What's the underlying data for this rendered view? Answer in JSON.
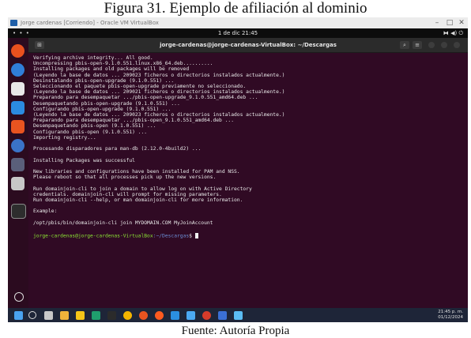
{
  "caption": {
    "top": "Figura 31. Ejemplo de afiliación al dominio",
    "bottom": "Fuente: Autoría Propia"
  },
  "vbox_window": {
    "title": "Jorge cardenas [Corriendo] - Oracle VM VirtualBox",
    "buttons": [
      "–",
      "□",
      "✕"
    ]
  },
  "gnome_bar": {
    "activities": "• • •",
    "clock": "1 de dic 21:45",
    "tray": "⧓ ◀) ⏻"
  },
  "terminal": {
    "title": "jorge-cardenas@jorge-cardenas-VirtualBox: ~/Descargas",
    "new_tab": "⊞",
    "lines": [
      "Verifying archive integrity... All good.",
      "Uncompressing pbis-open-9.1.0.551.linux.x86_64.deb..........",
      "Installing packages and old packages will be removed",
      "(Leyendo la base de datos ... 209023 ficheros o directorios instalados actualmente.)",
      "Desinstalando pbis-open-upgrade (9.1.0.551) ...",
      "Seleccionando el paquete pbis-open-upgrade previamente no seleccionado.",
      "(Leyendo la base de datos ... 209021 ficheros o directorios instalados actualmente.)",
      "Preparando para desempaquetar .../pbis-open-upgrade_9.1.0.551_amd64.deb ...",
      "Desempaquetando pbis-open-upgrade (9.1.0.551) ...",
      "Configurando pbis-open-upgrade (9.1.0.551) ...",
      "(Leyendo la base de datos ... 209023 ficheros o directorios instalados actualmente.)",
      "Preparando para desempaquetar .../pbis-open_9.1.0.551_amd64.deb ...",
      "Desempaquetando pbis-open (9.1.0.551) ...",
      "Configurando pbis-open (9.1.0.551) ...",
      "Importing registry...",
      "",
      "Procesando disparadores para man-db (2.12.0-4build2) ...",
      "",
      "Installing Packages was successful",
      "",
      "New libraries and configurations have been installed for PAM and NSS.",
      "Please reboot so that all processes pick up the new versions.",
      "",
      "Run domainjoin-cli to join a domain to allow log on with Active Directory",
      "credentials. domainjoin-cli will prompt for missing parameters.",
      "Run domainjoin-cli --help, or man domainjoin-cli for more information.",
      "",
      "Example:",
      "",
      "/opt/pbis/bin/domainjoin-cli join MYDOMAIN.COM MyJoinAccount",
      ""
    ],
    "prompt_user": "jorge-cardenas@jorge-cardenas-VirtualBox",
    "prompt_path": ":~/Descargas",
    "prompt_symbol": "$"
  },
  "taskbar": {
    "time": "21:45 p. m.",
    "date": "01/12/2024"
  },
  "colors": {
    "terminal_bg": "#300a24",
    "prompt_user": "#8ae234",
    "prompt_path": "#6b8ed6"
  }
}
